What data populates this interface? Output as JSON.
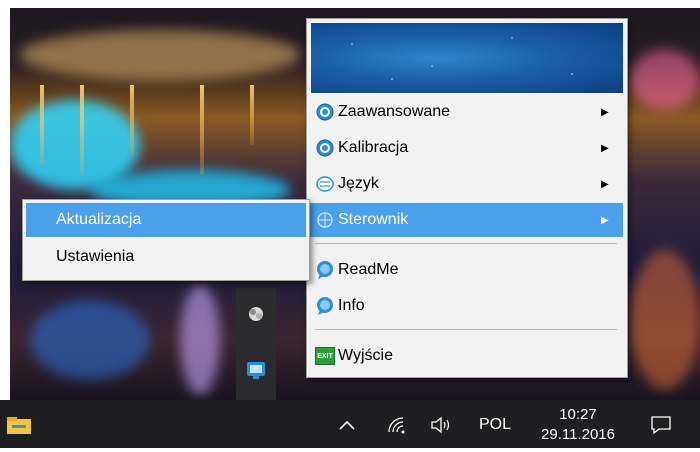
{
  "menu": {
    "items": [
      {
        "label": "Zaawansowane",
        "icon": "gear-globe-icon",
        "has_submenu": true
      },
      {
        "label": "Kalibracja",
        "icon": "gear-globe-icon",
        "has_submenu": true
      },
      {
        "label": "Język",
        "icon": "language-icon",
        "has_submenu": true
      },
      {
        "label": "Sterownik",
        "icon": "driver-icon",
        "has_submenu": true,
        "highlighted": true
      },
      {
        "label": "ReadMe",
        "icon": "speech-bubble-icon",
        "has_submenu": false
      },
      {
        "label": "Info",
        "icon": "speech-bubble-icon",
        "has_submenu": false
      },
      {
        "label": "Wyjście",
        "icon": "exit-icon",
        "has_submenu": false
      }
    ],
    "exit_icon_text": "EXIT"
  },
  "submenu": {
    "items": [
      {
        "label": "Aktualizacja",
        "highlighted": true
      },
      {
        "label": "Ustawienia",
        "highlighted": false
      }
    ]
  },
  "taskbar": {
    "language": "POL",
    "time": "10:27",
    "date": "29.11.2016"
  },
  "colors": {
    "highlight": "#4aa0ea",
    "menu_bg": "#f2f2f2",
    "taskbar_bg": "#1f1f22"
  }
}
